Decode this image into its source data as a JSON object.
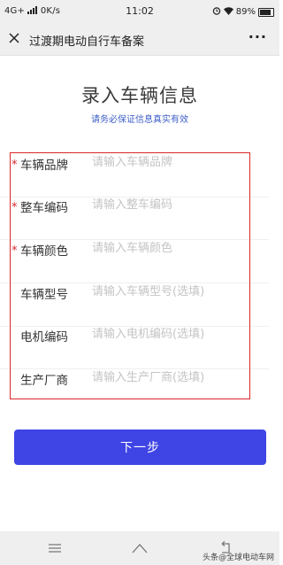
{
  "status_bar": {
    "network": "4G+",
    "speed": "0K/s",
    "time": "11:02",
    "battery": "89%"
  },
  "title_bar": {
    "title": "过渡期电动自行车备案",
    "more": "···"
  },
  "header": {
    "title": "录入车辆信息",
    "subtitle": "请务必保证信息真实有效"
  },
  "form": {
    "fields": [
      {
        "label": "车辆品牌",
        "placeholder": "请输入车辆品牌",
        "value": "",
        "required": true
      },
      {
        "label": "整车编码",
        "placeholder": "请输入整车编码",
        "value": "",
        "required": true
      },
      {
        "label": "车辆颜色",
        "placeholder": "请输入车辆颜色",
        "value": "",
        "required": true
      },
      {
        "label": "车辆型号",
        "placeholder": "请输入车辆型号(选填)",
        "value": "",
        "required": false
      },
      {
        "label": "电机编码",
        "placeholder": "请输入电机编码(选填)",
        "value": "",
        "required": false
      },
      {
        "label": "生产厂商",
        "placeholder": "请输入生产厂商(选填)",
        "value": "",
        "required": false
      }
    ],
    "required_mark": "*",
    "highlight_color": "#d9272b"
  },
  "actions": {
    "next_label": "下一步",
    "button_color": "#3f44e5"
  },
  "nav_bar": {
    "icons": [
      "menu-icon",
      "home-icon",
      "back-icon"
    ]
  },
  "watermark": "头条@全球电动车网"
}
